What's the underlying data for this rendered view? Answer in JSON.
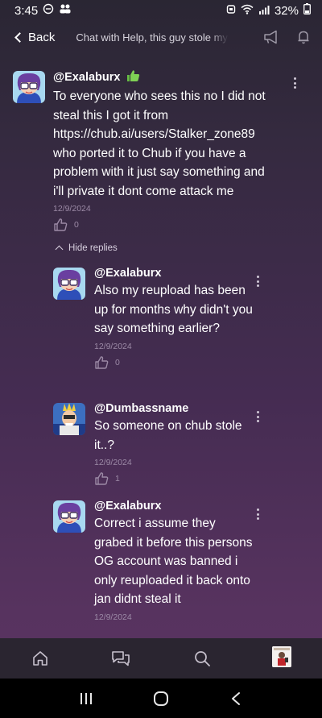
{
  "status": {
    "time": "3:45",
    "battery": "32%"
  },
  "header": {
    "back_label": "Back",
    "title": "Chat with Help, this guy stole my"
  },
  "main_comment": {
    "username": "@Exalaburx",
    "text": "To everyone who sees this no I did not steal this I got it from https://chub.ai/users/Stalker_zone89 who ported it to Chub if you have a problem with it just say something and i'll private it dont come attack me",
    "date": "12/9/2024",
    "likes": "0"
  },
  "hide_replies_label": "Hide replies",
  "replies": [
    {
      "username": "@Exalaburx",
      "text": "Also my reupload has been up for months why didn't you say something earlier?",
      "date": "12/9/2024",
      "likes": "0"
    },
    {
      "username": "@Dumbassname",
      "text": "So someone on chub stole it..?",
      "date": "12/9/2024",
      "likes": "1"
    },
    {
      "username": "@Exalaburx",
      "text": "Correct i assume they grabed it before this persons OG account was banned i only reuploaded it back onto jan didnt steal it",
      "date": "12/9/2024",
      "likes": ""
    }
  ],
  "nav": [
    "home-icon",
    "chat-icon",
    "search-icon",
    "profile-avatar"
  ],
  "colors": {
    "bg_top": "#2a2633",
    "bg_bottom": "#5a3462",
    "nav_bg": "#2a2530",
    "meta_text": "#9c8aa6"
  }
}
